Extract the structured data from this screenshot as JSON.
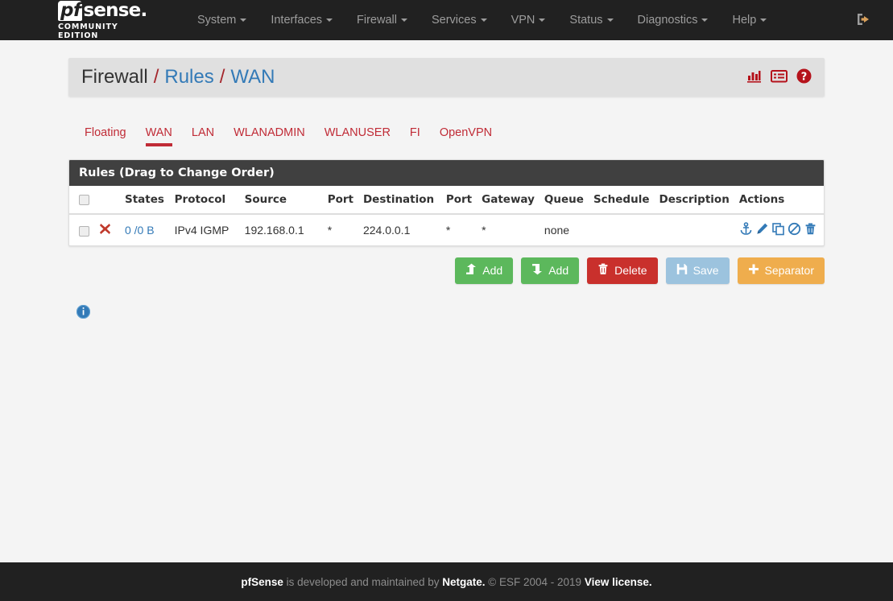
{
  "brand": {
    "name_pf": "pf",
    "name_sense": "sense",
    "edition": "COMMUNITY EDITION"
  },
  "navbar": {
    "items": [
      {
        "label": "System",
        "has_caret": true
      },
      {
        "label": "Interfaces",
        "has_caret": true
      },
      {
        "label": "Firewall",
        "has_caret": true
      },
      {
        "label": "Services",
        "has_caret": true
      },
      {
        "label": "VPN",
        "has_caret": true
      },
      {
        "label": "Status",
        "has_caret": true
      },
      {
        "label": "Diagnostics",
        "has_caret": true
      },
      {
        "label": "Help",
        "has_caret": true
      }
    ],
    "logout_icon": "logout-icon"
  },
  "breadcrumb": {
    "root": "Firewall",
    "sep1": "/",
    "section": "Rules",
    "sep2": "/",
    "current": "WAN",
    "icons": [
      {
        "name": "statistics-icon"
      },
      {
        "name": "log-icon"
      },
      {
        "name": "help-icon"
      }
    ]
  },
  "tabs": [
    {
      "label": "Floating",
      "active": false
    },
    {
      "label": "WAN",
      "active": true
    },
    {
      "label": "LAN",
      "active": false
    },
    {
      "label": "WLANADMIN",
      "active": false
    },
    {
      "label": "WLANUSER",
      "active": false
    },
    {
      "label": "FI",
      "active": false
    },
    {
      "label": "OpenVPN",
      "active": false
    }
  ],
  "panel": {
    "title": "Rules (Drag to Change Order)",
    "columns": [
      "",
      "",
      "States",
      "Protocol",
      "Source",
      "Port",
      "Destination",
      "Port",
      "Gateway",
      "Queue",
      "Schedule",
      "Description",
      "Actions"
    ],
    "rows": [
      {
        "selected": false,
        "status_icon": "block-icon",
        "states": "0 /0 B",
        "protocol": "IPv4 IGMP",
        "source": "192.168.0.1",
        "src_port": "*",
        "destination": "224.0.0.1",
        "dst_port": "*",
        "gateway": "*",
        "queue": "none",
        "schedule": "",
        "description": "",
        "actions": [
          "anchor-icon",
          "edit-icon",
          "copy-icon",
          "disable-icon",
          "delete-icon"
        ]
      }
    ]
  },
  "buttons": [
    {
      "label": "Add",
      "icon": "arrow-up-icon",
      "style": "btn-green"
    },
    {
      "label": "Add",
      "icon": "arrow-down-icon",
      "style": "btn-green"
    },
    {
      "label": "Delete",
      "icon": "trash-icon",
      "style": "btn-red"
    },
    {
      "label": "Save",
      "icon": "save-icon",
      "style": "btn-blue"
    },
    {
      "label": "Separator",
      "icon": "plus-icon",
      "style": "btn-orange"
    }
  ],
  "info": {
    "icon": "info-icon"
  },
  "footer": {
    "brand": "pfSense",
    "text1": " is developed and maintained by ",
    "netgate": "Netgate.",
    "copyright": " © ESF 2004 - 2019 ",
    "license": "View license."
  },
  "colors": {
    "navbar_bg": "#212121",
    "accent_red": "#c02b36",
    "link_blue": "#337ab7",
    "panel_heading": "#404040",
    "page_bg": "#f4f4f4",
    "header_bg": "#e0e0e0"
  }
}
